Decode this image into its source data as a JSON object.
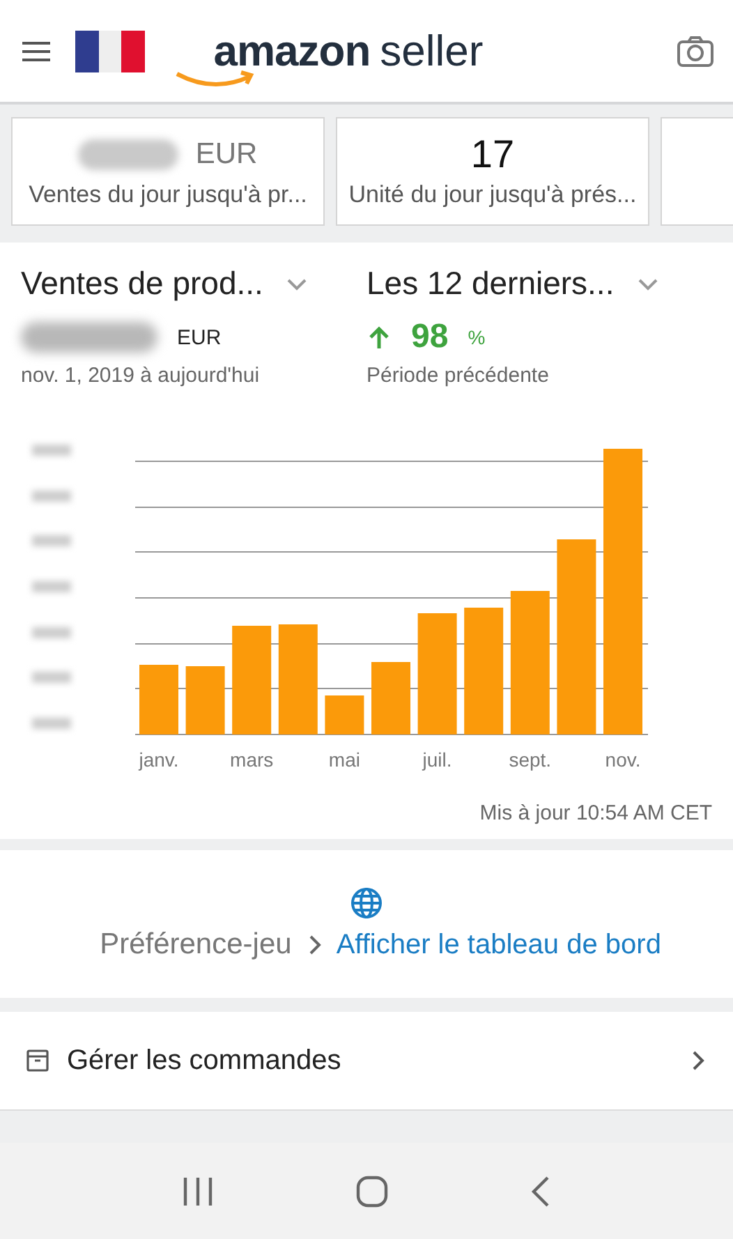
{
  "header": {
    "logo_word": "amazon",
    "logo_suffix": "seller"
  },
  "stat_cards": [
    {
      "kind": "stat",
      "unit": "EUR",
      "label": "Ventes du jour jusqu'à pr..."
    },
    {
      "kind": "stat",
      "value": "17",
      "label": "Unité du jour jusqu'à prés..."
    },
    {
      "kind": "empty"
    }
  ],
  "metric_dropdown": {
    "label": "Ventes de prod..."
  },
  "period_dropdown": {
    "label": "Les 12 derniers..."
  },
  "total": {
    "unit": "EUR",
    "range": "nov. 1, 2019 à aujourd'hui"
  },
  "change": {
    "value": "98",
    "unit": "%",
    "caption": "Période précédente"
  },
  "chart": {
    "month_labels": [
      "janv.",
      "mars",
      "mai",
      "juil.",
      "sept.",
      "nov."
    ]
  },
  "updated": "Mis à jour 10:54 AM CET",
  "preference": {
    "label": "Préférence-jeu",
    "link": "Afficher le tableau de bord"
  },
  "menu_rows": [
    {
      "label": "Gérer les commandes"
    }
  ]
}
